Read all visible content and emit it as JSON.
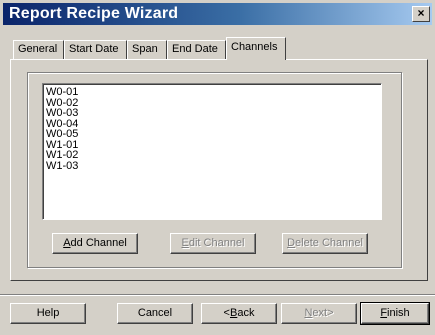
{
  "window": {
    "title": "Report Recipe Wizard",
    "close_glyph": "×"
  },
  "tabs": [
    {
      "label": "General"
    },
    {
      "label": "Start Date"
    },
    {
      "label": "Span"
    },
    {
      "label": "End Date"
    },
    {
      "label": "Channels",
      "active": true
    }
  ],
  "channels": {
    "items": [
      "W0-01",
      "W0-02",
      "W0-03",
      "W0-04",
      "W0-05",
      "W1-01",
      "W1-02",
      "W1-03"
    ],
    "add": {
      "mnemonic": "A",
      "rest": "dd Channel",
      "enabled": true
    },
    "edit": {
      "mnemonic": "E",
      "rest": "dit Channel",
      "enabled": false
    },
    "delete": {
      "mnemonic": "D",
      "rest": "elete Channel",
      "enabled": false
    }
  },
  "footer": {
    "help": "Help",
    "cancel": "Cancel",
    "back": {
      "prefix": "<",
      "mnemonic": "B",
      "rest": "ack",
      "enabled": true
    },
    "next": {
      "mnemonic": "N",
      "rest": "ext>",
      "enabled": false
    },
    "finish": {
      "mnemonic": "F",
      "rest": "inish",
      "enabled": true
    }
  },
  "colors": {
    "titlebar_start": "#0a246a",
    "titlebar_end": "#a6caf0",
    "face": "#d4d0c8"
  }
}
